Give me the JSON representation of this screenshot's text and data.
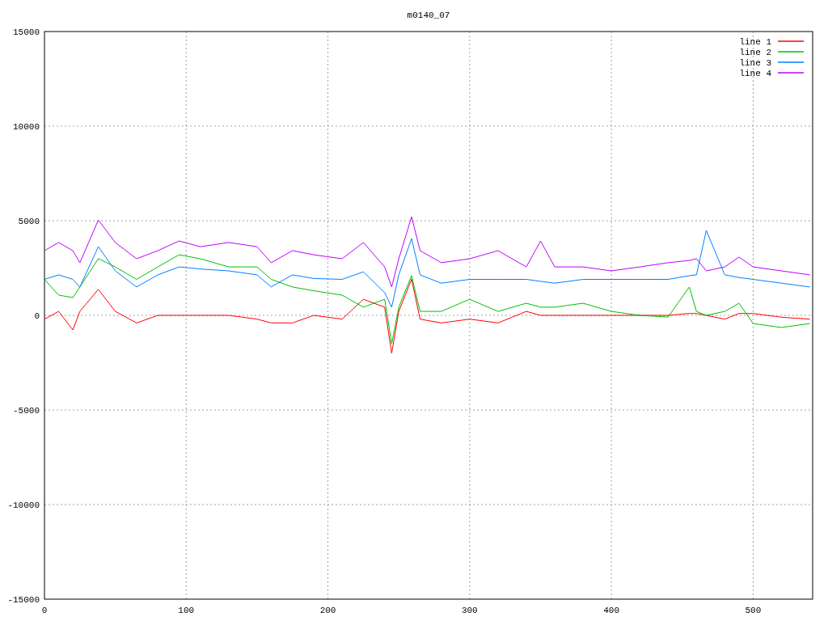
{
  "chart_data": {
    "type": "line",
    "title": "m0140_07",
    "x": [
      0,
      10,
      20,
      25,
      38,
      50,
      65,
      80,
      95,
      110,
      130,
      150,
      160,
      175,
      190,
      210,
      225,
      240,
      245,
      250,
      259,
      265,
      280,
      300,
      320,
      340,
      350,
      360,
      380,
      400,
      420,
      440,
      455,
      460,
      467,
      480,
      490,
      500,
      520,
      540
    ],
    "grid": true,
    "legend": true,
    "xlim": [
      0,
      542
    ],
    "ylim": [
      -15000,
      15000
    ],
    "xticks": [
      0,
      100,
      200,
      300,
      400,
      500
    ],
    "yticks": [
      -15000,
      -10000,
      -5000,
      0,
      5000,
      10000,
      15000
    ],
    "series": [
      {
        "name": "line 1",
        "color": "#ff0000",
        "values": [
          -200,
          210,
          -770,
          210,
          1370,
          210,
          -400,
          0,
          0,
          0,
          0,
          -200,
          -400,
          -400,
          0,
          -200,
          850,
          430,
          -2000,
          210,
          1920,
          -200,
          -400,
          -200,
          -400,
          210,
          0,
          0,
          0,
          0,
          0,
          0,
          100,
          100,
          0,
          -200,
          100,
          100,
          -100,
          -200
        ]
      },
      {
        "name": "line 2",
        "color": "#00c000",
        "values": [
          1900,
          1070,
          940,
          1500,
          3000,
          2560,
          1900,
          2560,
          3200,
          2990,
          2560,
          2560,
          1900,
          1500,
          1300,
          1070,
          430,
          850,
          -1500,
          430,
          2100,
          210,
          210,
          850,
          210,
          640,
          430,
          430,
          640,
          210,
          0,
          -90,
          1500,
          210,
          0,
          210,
          640,
          -430,
          -640,
          -430
        ]
      },
      {
        "name": "line 3",
        "color": "#0080ff",
        "values": [
          1900,
          2140,
          1900,
          1500,
          3630,
          2350,
          1500,
          2140,
          2560,
          2450,
          2350,
          2140,
          1500,
          2140,
          1950,
          1900,
          2300,
          1200,
          430,
          2140,
          4060,
          2140,
          1700,
          1900,
          1900,
          1900,
          1800,
          1700,
          1900,
          1900,
          1900,
          1900,
          2100,
          2140,
          4490,
          2140,
          2000,
          1900,
          1700,
          1500
        ]
      },
      {
        "name": "line 4",
        "color": "#c000ff",
        "values": [
          3420,
          3850,
          3420,
          2780,
          5040,
          3850,
          2990,
          3420,
          3930,
          3630,
          3850,
          3630,
          2780,
          3420,
          3200,
          2990,
          3850,
          2560,
          1500,
          2990,
          5210,
          3420,
          2780,
          2990,
          3420,
          2560,
          3930,
          2560,
          2560,
          2350,
          2560,
          2780,
          2900,
          2990,
          2350,
          2560,
          3080,
          2560,
          2350,
          2140
        ]
      }
    ]
  }
}
